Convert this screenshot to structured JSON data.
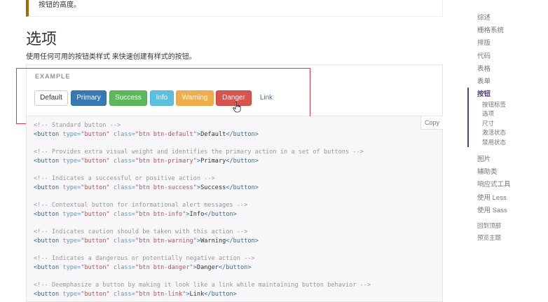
{
  "callout": {
    "text": "按钮的高度。"
  },
  "section": {
    "title": "选项",
    "description": "使用任何可用的按钮类样式 来快速创建有样式的按钮。"
  },
  "example": {
    "label": "EXAMPLE",
    "buttons": {
      "default": "Default",
      "primary": "Primary",
      "success": "Success",
      "info": "Info",
      "warning": "Warning",
      "danger": "Danger",
      "link": "Link"
    }
  },
  "code": {
    "copy_label": "Copy",
    "blocks": [
      {
        "comment": "<!-- Standard button -->",
        "btn_class": "\"btn btn-default\"",
        "text": "Default"
      },
      {
        "comment": "<!-- Provides extra visual weight and identifies the primary action in a set of buttons -->",
        "btn_class": "\"btn btn-primary\"",
        "text": "Primary"
      },
      {
        "comment": "<!-- Indicates a successful or positive action -->",
        "btn_class": "\"btn btn-success\"",
        "text": "Success"
      },
      {
        "comment": "<!-- Contextual button for informational alert messages -->",
        "btn_class": "\"btn btn-info\"",
        "text": "Info"
      },
      {
        "comment": "<!-- Indicates caution should be taken with this action -->",
        "btn_class": "\"btn btn-warning\"",
        "text": "Warning"
      },
      {
        "comment": "<!-- Indicates a dangerous or potentially negative action -->",
        "btn_class": "\"btn btn-danger\"",
        "text": "Danger"
      },
      {
        "comment": "<!-- Deemphasize a button by making it look like a link while maintaining button behavior -->",
        "btn_class": "\"btn btn-link\"",
        "text": "Link"
      }
    ],
    "tag_open": "<button",
    "attr_type": "type=",
    "type_value": "\"button\"",
    "attr_class": "class=",
    "tag_close": "</button>"
  },
  "sidebar": {
    "items": [
      "综述",
      "栅格系统",
      "排版",
      "代码",
      "表格",
      "表单",
      "按钮"
    ],
    "active_item": "按钮",
    "sub_items": [
      "按钮标签",
      "选项",
      "尺寸",
      "激活状态",
      "禁用状态"
    ],
    "items_after": [
      "图片",
      "辅助类",
      "响应式工具",
      "使用 Less",
      "使用 Sass"
    ],
    "footer": [
      "回到顶部",
      "预览主题"
    ]
  },
  "colors": {
    "accent": "#563d7c",
    "primary": "#337ab7",
    "success": "#5cb85c",
    "info": "#5bc0de",
    "warning": "#f0ad4e",
    "danger": "#d9534f",
    "annotation": "#e03a3a"
  }
}
